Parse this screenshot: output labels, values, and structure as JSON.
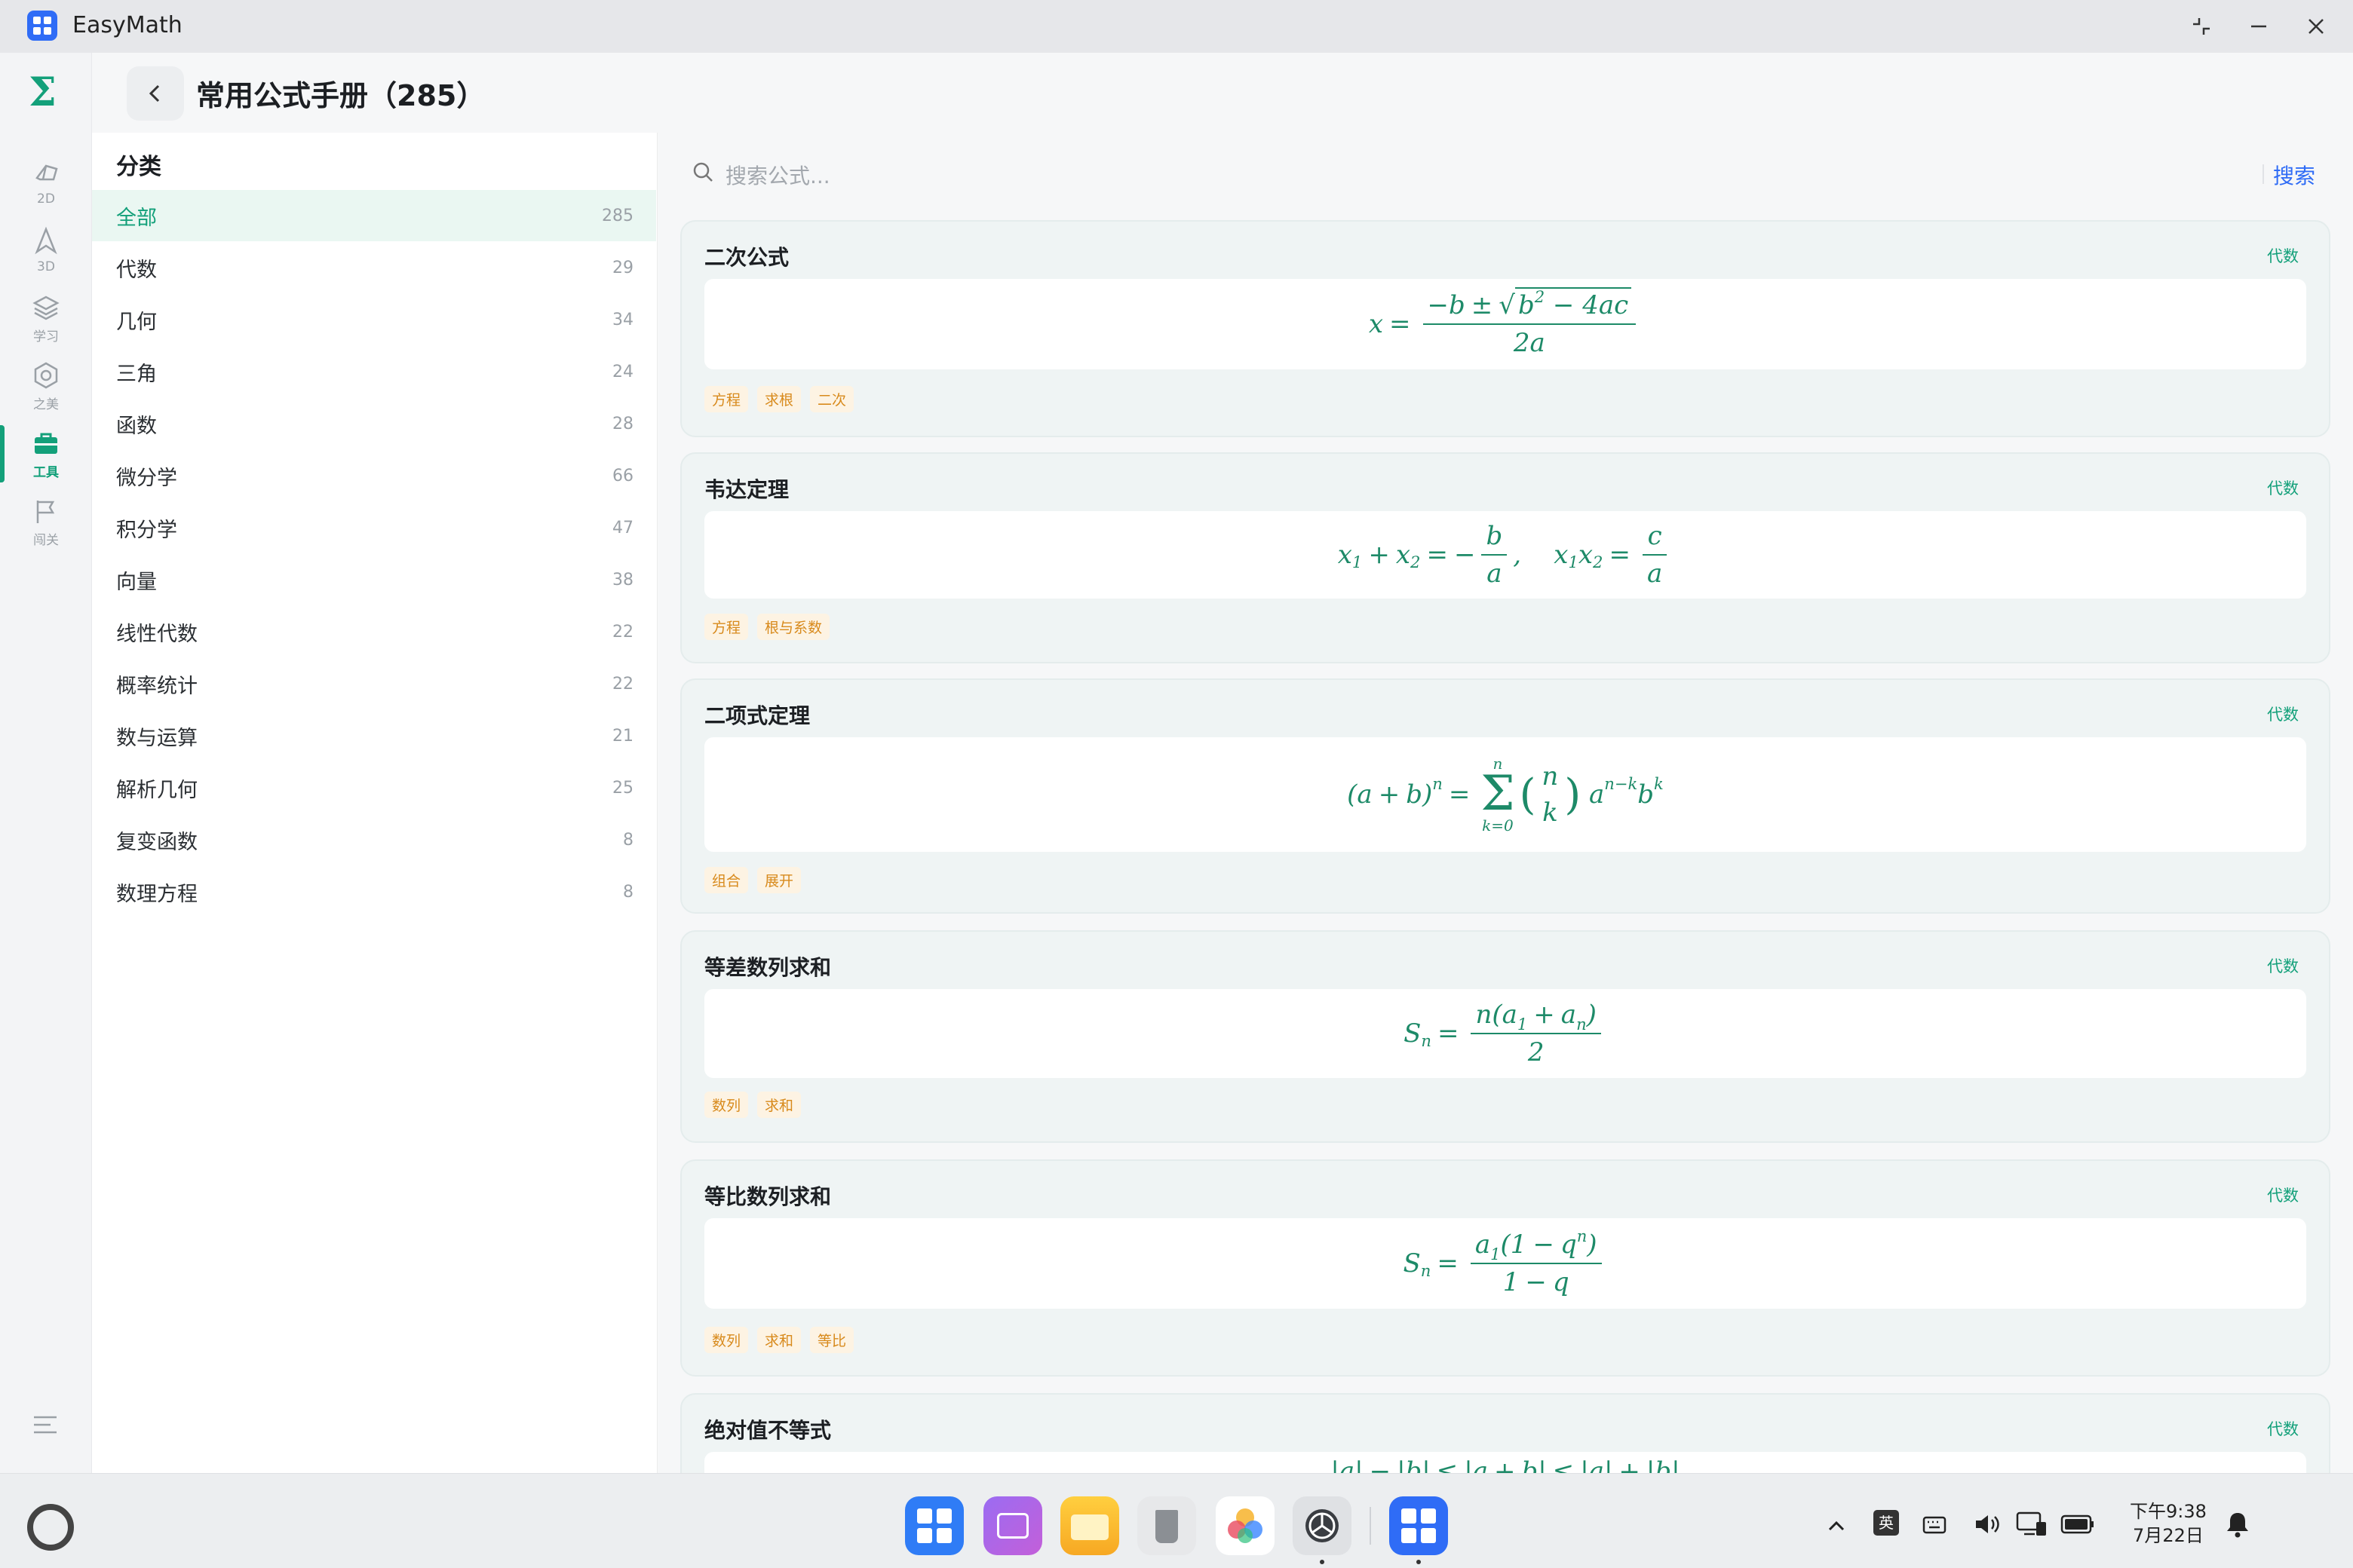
{
  "window": {
    "title": "EasyMath"
  },
  "brand": {
    "logo": "Σ"
  },
  "nav": [
    {
      "label": "2D",
      "icon": "eraser-icon"
    },
    {
      "label": "3D",
      "icon": "navigation-icon"
    },
    {
      "label": "学习",
      "icon": "layers-icon"
    },
    {
      "label": "之美",
      "icon": "hexagon-icon"
    },
    {
      "label": "工具",
      "icon": "toolbox-icon",
      "active": true
    },
    {
      "label": "闯关",
      "icon": "flag-icon"
    }
  ],
  "page": {
    "title": "常用公式手册（285）"
  },
  "categories": {
    "heading": "分类",
    "items": [
      {
        "name": "全部",
        "count": "285",
        "active": true
      },
      {
        "name": "代数",
        "count": "29"
      },
      {
        "name": "几何",
        "count": "34"
      },
      {
        "name": "三角",
        "count": "24"
      },
      {
        "name": "函数",
        "count": "28"
      },
      {
        "name": "微分学",
        "count": "66"
      },
      {
        "name": "积分学",
        "count": "47"
      },
      {
        "name": "向量",
        "count": "38"
      },
      {
        "name": "线性代数",
        "count": "22"
      },
      {
        "name": "概率统计",
        "count": "22"
      },
      {
        "name": "数与运算",
        "count": "21"
      },
      {
        "name": "解析几何",
        "count": "25"
      },
      {
        "name": "复变函数",
        "count": "8"
      },
      {
        "name": "数理方程",
        "count": "8"
      }
    ]
  },
  "search": {
    "placeholder": "搜索公式...",
    "button": "搜索"
  },
  "formulas": [
    {
      "title": "二次公式",
      "category": "代数",
      "tags": [
        "方程",
        "求根",
        "二次"
      ]
    },
    {
      "title": "韦达定理",
      "category": "代数",
      "tags": [
        "方程",
        "根与系数"
      ]
    },
    {
      "title": "二项式定理",
      "category": "代数",
      "tags": [
        "组合",
        "展开"
      ]
    },
    {
      "title": "等差数列求和",
      "category": "代数",
      "tags": [
        "数列",
        "求和"
      ]
    },
    {
      "title": "等比数列求和",
      "category": "代数",
      "tags": [
        "数列",
        "求和",
        "等比"
      ]
    },
    {
      "title": "绝对值不等式",
      "category": "代数",
      "tags": []
    }
  ],
  "taskbar": {
    "ime": "英",
    "time": "下午9:38",
    "date": "7月22日"
  },
  "colors": {
    "accent": "#13a07a",
    "link": "#2f6cf6",
    "tag": "#d88a1c"
  }
}
